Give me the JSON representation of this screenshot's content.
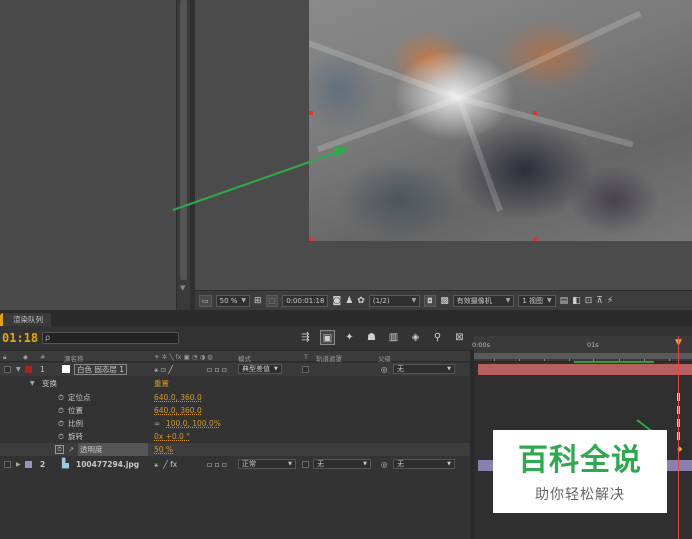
{
  "viewer": {
    "zoom": "50 %",
    "timecode": "0:00:01:18",
    "resolution": "(1/2)",
    "camera": "有效摄像机",
    "views": "1 视图"
  },
  "timeline": {
    "render_tab": "渲染队列",
    "timecode": "01:18",
    "search_placeholder": "ρ",
    "columns": {
      "num": "#",
      "source_name": "源名称",
      "mode": "模式",
      "t": "T",
      "trkmat": "轨道遮罩",
      "parent": "父级"
    },
    "ruler": {
      "start": "0:00s",
      "mark": "01s"
    },
    "layers": [
      {
        "index": "1",
        "name": "白色 固态层 1",
        "mode": "典型差值",
        "parent": "无",
        "color": "#b02020"
      },
      {
        "index": "2",
        "name": "100477294.jpg",
        "mode": "正常",
        "trkmat": "无",
        "parent": "无",
        "color": "#a090c0"
      }
    ],
    "transform": {
      "label": "变换",
      "reset": "重置",
      "properties": [
        {
          "name": "定位点",
          "value": "640.0, 360.0"
        },
        {
          "name": "位置",
          "value": "640.0, 360.0"
        },
        {
          "name": "比例",
          "value": "100.0, 100.0%"
        },
        {
          "name": "旋转",
          "value": "0x +0.0 °"
        },
        {
          "name": "透明度",
          "value": "50 %"
        }
      ]
    }
  },
  "watermark": {
    "title": "百科全说",
    "subtitle": "助你轻松解决"
  },
  "colors": {
    "accent_orange": "#e4a817",
    "value_orange": "#d79a28",
    "layer1_bar": "#b86060",
    "layer2_bar": "#8a80b0",
    "arrow_green": "#2faa4a"
  }
}
